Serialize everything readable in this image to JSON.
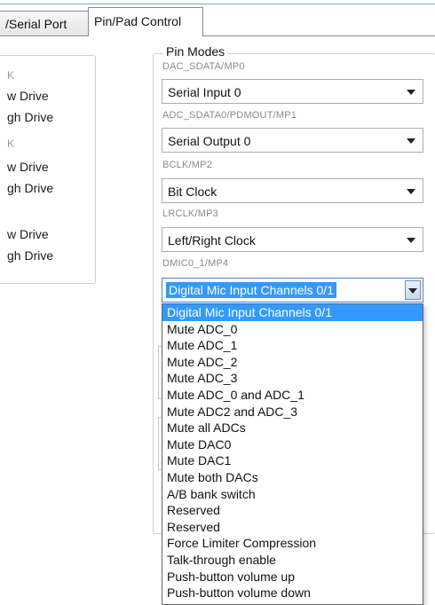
{
  "tabs": [
    {
      "label": "/Serial Port"
    },
    {
      "label": "Pin/Pad Control"
    }
  ],
  "left_group": {
    "lines": [
      "K",
      "w Drive",
      "gh Drive",
      "K",
      "w Drive",
      "gh Drive",
      "w Drive",
      "gh Drive"
    ]
  },
  "pin_modes": {
    "title": "Pin Modes",
    "pins": [
      {
        "label": "DAC_SDATA/MP0",
        "value": "Serial Input 0"
      },
      {
        "label": "ADC_SDATA0/PDMOUT/MP1",
        "value": "Serial Output 0"
      },
      {
        "label": "BCLK/MP2",
        "value": "Bit Clock"
      },
      {
        "label": "LRCLK/MP3",
        "value": "Left/Right Clock"
      },
      {
        "label": "DMIC0_1/MP4",
        "value": "Digital Mic Input Channels 0/1"
      }
    ]
  },
  "dropdown": {
    "selected_index": 0,
    "options": [
      "Digital Mic Input Channels 0/1",
      "Mute ADC_0",
      "Mute ADC_1",
      "Mute ADC_2",
      "Mute ADC_3",
      "Mute ADC_0 and ADC_1",
      "Mute ADC2 and ADC_3",
      "Mute all ADCs",
      "Mute DAC0",
      "Mute DAC1",
      "Mute both DACs",
      "A/B bank switch",
      "Reserved",
      "Reserved",
      "Force Limiter Compression",
      "Talk-through enable",
      "Push-button volume up",
      "Push-button volume down"
    ]
  },
  "colors": {
    "selection": "#3399ff",
    "border": "#adadad",
    "disabled_text": "#8a8a8a"
  }
}
